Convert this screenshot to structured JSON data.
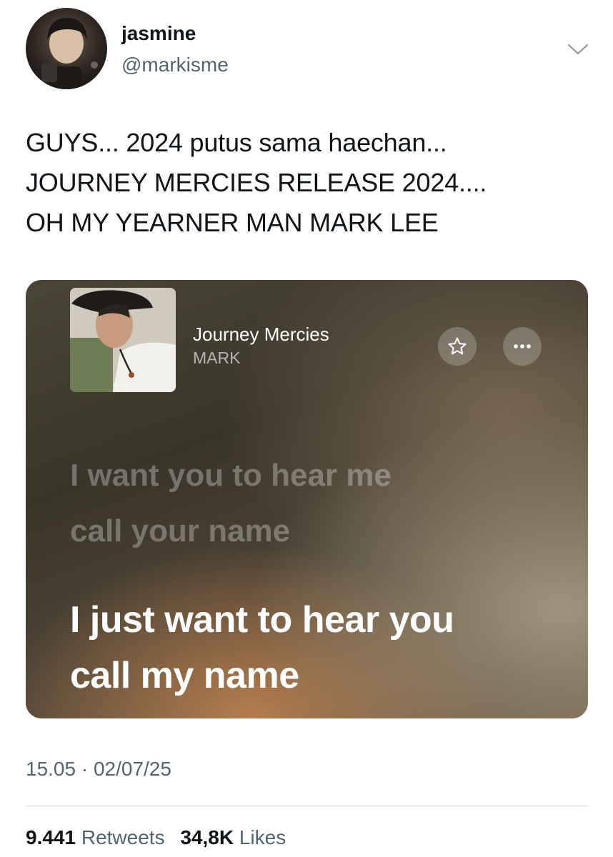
{
  "author": {
    "display_name": "jasmine",
    "username": "@markisme",
    "avatar_icon": "profile-photo"
  },
  "tweet": {
    "lines": [
      "GUYS... 2024 putus sama haechan...",
      "JOURNEY MERCIES RELEASE 2024....",
      "OH MY YEARNER MAN MARK LEE"
    ]
  },
  "media": {
    "song_title": "Journey Mercies",
    "artist": "MARK",
    "album_caption": "MARK",
    "favorite_icon": "star-icon",
    "more_icon": "ellipsis-icon",
    "lyrics_previous": [
      "I want you to hear me",
      "call your name"
    ],
    "lyrics_current": [
      "I just want to hear you",
      "call my name"
    ]
  },
  "meta": {
    "timestamp": "15.05 · 02/07/25"
  },
  "stats": {
    "retweets_count": "9.441",
    "retweets_label": "Retweets",
    "likes_count": "34,8K",
    "likes_label": "Likes"
  },
  "colors": {
    "text_primary": "#0f1419",
    "text_secondary": "#536471",
    "divider": "#cfd9de"
  }
}
